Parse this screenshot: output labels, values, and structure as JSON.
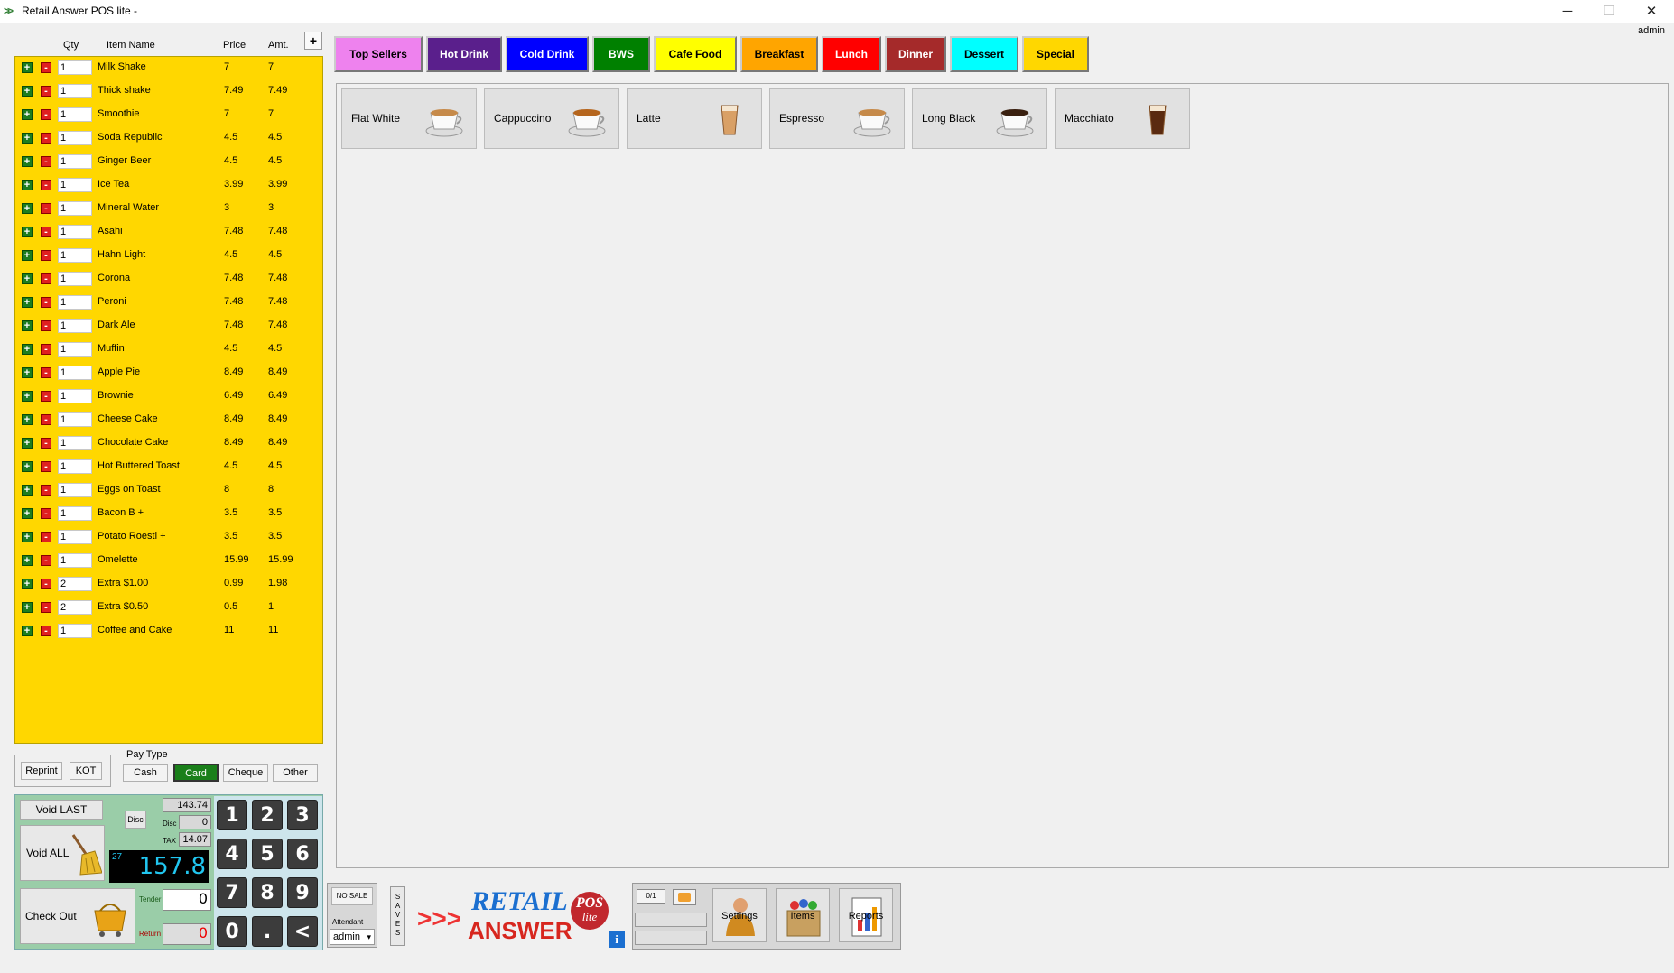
{
  "window": {
    "title": "Retail Answer POS lite -",
    "minimize": "─",
    "maximize": "☐",
    "close": "✕",
    "user": "admin"
  },
  "order": {
    "headers": {
      "qty": "Qty",
      "item": "Item Name",
      "price": "Price",
      "amt": "Amt."
    },
    "add_label": "+",
    "plus_glyph": "+",
    "minus_glyph": "-",
    "rows": [
      {
        "qty": "1",
        "name": "Milk Shake",
        "price": "7",
        "amt": "7"
      },
      {
        "qty": "1",
        "name": "Thick shake",
        "price": "7.49",
        "amt": "7.49"
      },
      {
        "qty": "1",
        "name": "Smoothie",
        "price": "7",
        "amt": "7"
      },
      {
        "qty": "1",
        "name": "Soda Republic",
        "price": "4.5",
        "amt": "4.5"
      },
      {
        "qty": "1",
        "name": "Ginger Beer",
        "price": "4.5",
        "amt": "4.5"
      },
      {
        "qty": "1",
        "name": "Ice Tea",
        "price": "3.99",
        "amt": "3.99"
      },
      {
        "qty": "1",
        "name": "Mineral Water",
        "price": "3",
        "amt": "3"
      },
      {
        "qty": "1",
        "name": "Asahi",
        "price": "7.48",
        "amt": "7.48"
      },
      {
        "qty": "1",
        "name": "Hahn Light",
        "price": "4.5",
        "amt": "4.5"
      },
      {
        "qty": "1",
        "name": "Corona",
        "price": "7.48",
        "amt": "7.48"
      },
      {
        "qty": "1",
        "name": "Peroni",
        "price": "7.48",
        "amt": "7.48"
      },
      {
        "qty": "1",
        "name": "Dark Ale",
        "price": "7.48",
        "amt": "7.48"
      },
      {
        "qty": "1",
        "name": "Muffin",
        "price": "4.5",
        "amt": "4.5"
      },
      {
        "qty": "1",
        "name": "Apple Pie",
        "price": "8.49",
        "amt": "8.49"
      },
      {
        "qty": "1",
        "name": "Brownie",
        "price": "6.49",
        "amt": "6.49"
      },
      {
        "qty": "1",
        "name": "Cheese Cake",
        "price": "8.49",
        "amt": "8.49"
      },
      {
        "qty": "1",
        "name": "Chocolate Cake",
        "price": "8.49",
        "amt": "8.49"
      },
      {
        "qty": "1",
        "name": "Hot Buttered Toast",
        "price": "4.5",
        "amt": "4.5"
      },
      {
        "qty": "1",
        "name": "Eggs on Toast",
        "price": "8",
        "amt": "8"
      },
      {
        "qty": "1",
        "name": "Bacon B +",
        "price": "3.5",
        "amt": "3.5"
      },
      {
        "qty": "1",
        "name": "Potato Roesti +",
        "price": "3.5",
        "amt": "3.5"
      },
      {
        "qty": "1",
        "name": "Omelette",
        "price": "15.99",
        "amt": "15.99"
      },
      {
        "qty": "2",
        "name": "Extra $1.00",
        "price": "0.99",
        "amt": "1.98"
      },
      {
        "qty": "2",
        "name": "Extra $0.50",
        "price": "0.5",
        "amt": "1"
      },
      {
        "qty": "1",
        "name": "Coffee and Cake",
        "price": "11",
        "amt": "11"
      }
    ]
  },
  "actions": {
    "reprint": "Reprint",
    "kot": "KOT"
  },
  "pay_type": {
    "label": "Pay Type",
    "options": [
      "Cash",
      "Card",
      "Cheque",
      "Other"
    ],
    "selected": "Card",
    "selected_color": "#1a7f1a"
  },
  "register": {
    "void_last": "Void LAST",
    "void_all": "Void ALL",
    "check_out": "Check Out",
    "disc_button": "Disc",
    "subtotal": "143.74",
    "disc_label": "Disc",
    "disc_value": "0",
    "tax_label": "TAX",
    "tax_value": "14.07",
    "total_count": "27",
    "total": "157.8",
    "tender_label": "Tender",
    "tender_value": "0",
    "return_label": "Return",
    "return_value": "0"
  },
  "keypad": [
    "1",
    "2",
    "3",
    "4",
    "5",
    "6",
    "7",
    "8",
    "9",
    "0",
    ".",
    "<"
  ],
  "categories": [
    {
      "label": "Top Sellers",
      "bg": "#ee82ee",
      "fg": "#000000"
    },
    {
      "label": "Hot Drink",
      "bg": "#5a1f8c",
      "fg": "#ffffff"
    },
    {
      "label": "Cold Drink",
      "bg": "#0000ff",
      "fg": "#ffffff"
    },
    {
      "label": "BWS",
      "bg": "#008000",
      "fg": "#ffffff"
    },
    {
      "label": "Cafe Food",
      "bg": "#ffff00",
      "fg": "#000000"
    },
    {
      "label": "Breakfast",
      "bg": "#ffa500",
      "fg": "#000000"
    },
    {
      "label": "Lunch",
      "bg": "#ff0000",
      "fg": "#ffffff"
    },
    {
      "label": "Dinner",
      "bg": "#a52a2a",
      "fg": "#ffffff"
    },
    {
      "label": "Dessert",
      "bg": "#00ffff",
      "fg": "#000000"
    },
    {
      "label": "Special",
      "bg": "#ffd700",
      "fg": "#000000"
    }
  ],
  "products": [
    {
      "label": "Flat White",
      "icon": "flat-white-cup-icon"
    },
    {
      "label": "Cappuccino",
      "icon": "cappuccino-cup-icon"
    },
    {
      "label": "Latte",
      "icon": "latte-glass-icon"
    },
    {
      "label": "Espresso",
      "icon": "espresso-cup-icon"
    },
    {
      "label": "Long Black",
      "icon": "long-black-cup-icon"
    },
    {
      "label": "Macchiato",
      "icon": "macchiato-glass-icon"
    }
  ],
  "footer": {
    "no_sale": "NO SALE",
    "attendant_label": "Attendant",
    "attendant_value": "admin",
    "saves": "SAVES",
    "logo_top": "RETAIL",
    "logo_bottom": "ANSWER",
    "logo_badge_top": "POS",
    "logo_badge_bottom": "lite",
    "logo_arrows": ">>>",
    "info": "i",
    "settings": "Settings",
    "items": "Items",
    "reports": "Reports",
    "mini_display": "0/1"
  }
}
